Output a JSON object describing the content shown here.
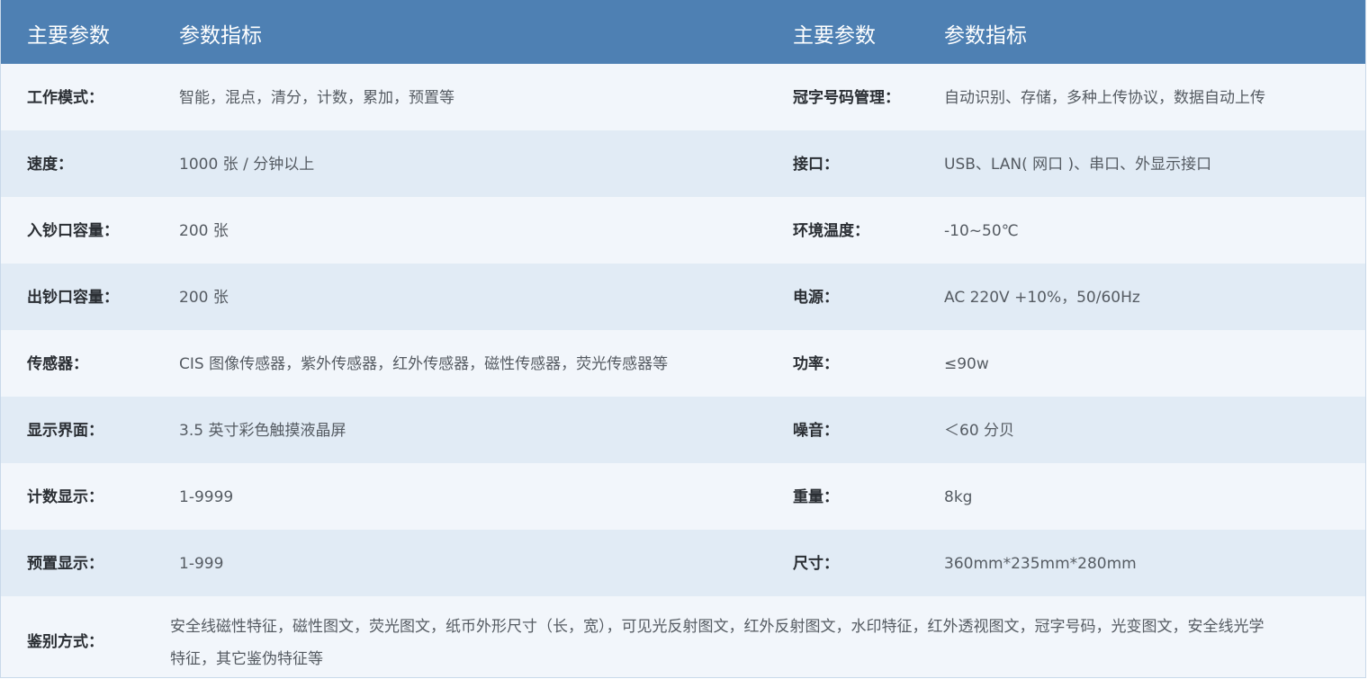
{
  "header": {
    "left_param": "主要参数",
    "left_value": "参数指标",
    "right_param": "主要参数",
    "right_value": "参数指标"
  },
  "rows": [
    {
      "left_key": "工作模式：",
      "left_value": "智能，混点，清分，计数，累加，预置等",
      "right_key": "冠字号码管理：",
      "right_value": "自动识别、存储，多种上传协议，数据自动上传"
    },
    {
      "left_key": "速度：",
      "left_value": "1000 张 / 分钟以上",
      "right_key": "接口：",
      "right_value": "USB、LAN( 网口 )、串口、外显示接口"
    },
    {
      "left_key": "入钞口容量：",
      "left_value": "200 张",
      "right_key": "环境温度：",
      "right_value": "-10~50℃"
    },
    {
      "left_key": "出钞口容量：",
      "left_value": "200 张",
      "right_key": "电源：",
      "right_value": "AC 220V +10%，50/60Hz"
    },
    {
      "left_key": "传感器：",
      "left_value": "CIS 图像传感器，紫外传感器，红外传感器，磁性传感器，荧光传感器等",
      "right_key": "功率：",
      "right_value": "≤90w"
    },
    {
      "left_key": "显示界面：",
      "left_value": "3.5 英寸彩色触摸液晶屏",
      "right_key": "噪音：",
      "right_value": "＜60 分贝"
    },
    {
      "left_key": "计数显示：",
      "left_value": "1-9999",
      "right_key": "重量：",
      "right_value": "8kg"
    },
    {
      "left_key": "预置显示：",
      "left_value": "1-999",
      "right_key": "尺寸：",
      "right_value": "360mm*235mm*280mm"
    }
  ],
  "last_row": {
    "key": "鉴别方式：",
    "value": "安全线磁性特征，磁性图文，荧光图文，纸币外形尺寸（长，宽），可见光反射图文，红外反射图文，水印特征，红外透视图文，冠字号码，光变图文，安全线光学特征，其它鉴伪特征等"
  },
  "colors": {
    "header_bg": "#4e80b3",
    "row_light": "#f2f6fb",
    "row_dark": "#e1ebf5"
  }
}
